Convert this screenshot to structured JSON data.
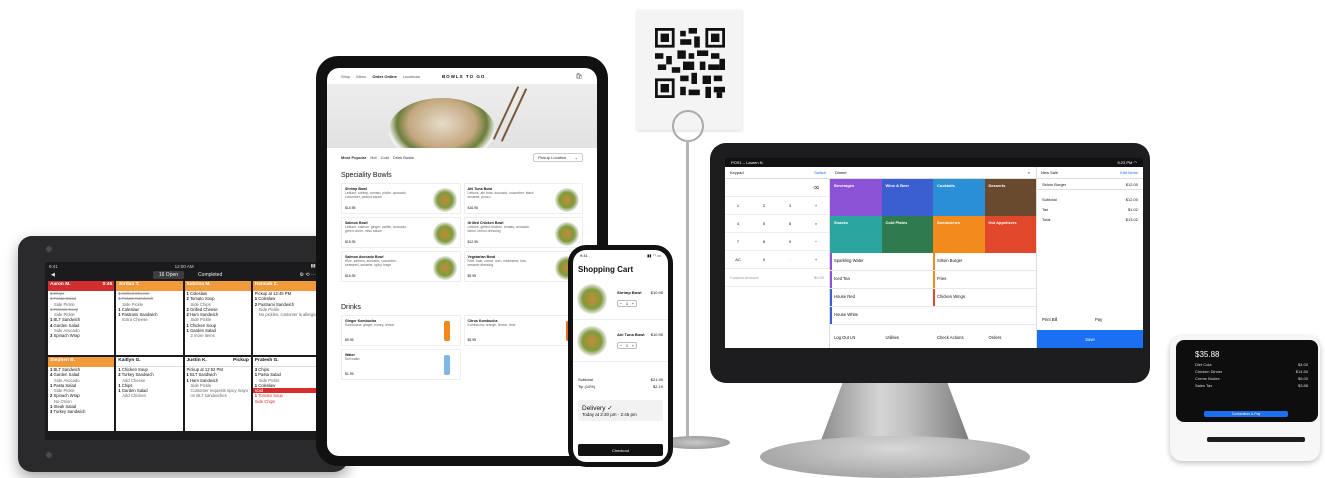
{
  "kds": {
    "status_left": "9:41",
    "status_right": "12:00 AM",
    "back": "◀",
    "tab_open": "16 Open",
    "tab_completed": "Completed",
    "tickets": [
      {
        "color": "#d12f2f",
        "name": "Aaron M.",
        "time": "0:45",
        "lines": [
          {
            "q": "1",
            "t": "Chips",
            "cls": "strike"
          },
          {
            "q": "1",
            "t": "Pasta Salad",
            "cls": "strike"
          },
          {
            "q": "",
            "t": "Side Pickle",
            "cls": "sub"
          },
          {
            "q": "1",
            "t": "Tomato Soup",
            "cls": "strike"
          },
          {
            "q": "",
            "t": "Side Pickle",
            "cls": "sub"
          },
          {
            "q": "1",
            "t": "BLT Sandwich",
            "cls": ""
          },
          {
            "q": "4",
            "t": "Garden Salad",
            "cls": ""
          },
          {
            "q": "",
            "t": "Side Avocado",
            "cls": "sub"
          },
          {
            "q": "3",
            "t": "Spinach Wrap",
            "cls": ""
          }
        ]
      },
      {
        "color": "#f2993a",
        "name": "Jordan T.",
        "time": "",
        "lines": [
          {
            "q": "1",
            "t": "Grilled Cheese",
            "cls": "strike"
          },
          {
            "q": "1",
            "t": "Potato Sandwich",
            "cls": "strike"
          },
          {
            "q": "",
            "t": "Side Pickle",
            "cls": "sub"
          },
          {
            "q": "1",
            "t": "Coleslaw",
            "cls": ""
          },
          {
            "q": "1",
            "t": "Pastrami Sandwich",
            "cls": ""
          },
          {
            "q": "",
            "t": "Extra Cheese",
            "cls": "sub"
          }
        ]
      },
      {
        "color": "#f2993a",
        "name": "Sabrina M.",
        "time": "",
        "lines": [
          {
            "q": "1",
            "t": "Coleslaw",
            "cls": ""
          },
          {
            "q": "2",
            "t": "Tomato Soup",
            "cls": ""
          },
          {
            "q": "",
            "t": "Side Chips",
            "cls": "sub"
          },
          {
            "q": "2",
            "t": "Grilled Cheese",
            "cls": ""
          },
          {
            "q": "2",
            "t": "Ham Sandwich",
            "cls": ""
          },
          {
            "q": "",
            "t": "Side Pickle",
            "cls": "sub"
          },
          {
            "q": "1",
            "t": "Chicken Soup",
            "cls": ""
          },
          {
            "q": "1",
            "t": "Garden Salad",
            "cls": ""
          },
          {
            "q": "",
            "t": "2 more items",
            "cls": "sub"
          }
        ]
      },
      {
        "color": "#f2993a",
        "name": "Hannah Z.",
        "time": "",
        "lines": [
          {
            "q": "",
            "t": "Pickup at 12:45 PM",
            "cls": ""
          },
          {
            "q": "1",
            "t": "Coleslaw",
            "cls": ""
          },
          {
            "q": "2",
            "t": "Pastrami Sandwich",
            "cls": ""
          },
          {
            "q": "",
            "t": "Side Pickle",
            "cls": "sub"
          },
          {
            "q": "",
            "t": "No pickles, customer is allergic",
            "cls": "sub"
          }
        ]
      },
      {
        "color": "#f2993a",
        "name": "Stephen B.",
        "time": "",
        "lines": [
          {
            "q": "1",
            "t": "BLT Sandwich",
            "cls": ""
          },
          {
            "q": "4",
            "t": "Garden Salad",
            "cls": ""
          },
          {
            "q": "",
            "t": "Side Avocado",
            "cls": "sub"
          },
          {
            "q": "1",
            "t": "Pasta Salad",
            "cls": ""
          },
          {
            "q": "",
            "t": "Side Pickle",
            "cls": "sub"
          },
          {
            "q": "2",
            "t": "Spinach Wrap",
            "cls": ""
          },
          {
            "q": "",
            "t": "No Onion",
            "cls": "sub"
          },
          {
            "q": "1",
            "t": "Steak Salad",
            "cls": ""
          },
          {
            "q": "3",
            "t": "Turkey Sandwich",
            "cls": ""
          }
        ]
      },
      {
        "color": "#ffffff",
        "name": "Kaitlyn G.",
        "time": "",
        "lines": [
          {
            "q": "1",
            "t": "Chicken Soup",
            "cls": ""
          },
          {
            "q": "2",
            "t": "Turkey Sandwich",
            "cls": ""
          },
          {
            "q": "",
            "t": "Add Cheese",
            "cls": "sub"
          },
          {
            "q": "1",
            "t": "Chips",
            "cls": ""
          },
          {
            "q": "1",
            "t": "Garden Salad",
            "cls": ""
          },
          {
            "q": "",
            "t": "Add Chicken",
            "cls": "sub"
          }
        ]
      },
      {
        "color": "#ffffff",
        "name": "Justin K.",
        "time": "Pickup",
        "lines": [
          {
            "q": "",
            "t": "Pickup at 12:52 PM",
            "cls": ""
          },
          {
            "q": "1",
            "t": "BLT Sandwich",
            "cls": ""
          },
          {
            "q": "1",
            "t": "Ham Sandwich",
            "cls": ""
          },
          {
            "q": "",
            "t": "Side Pickle",
            "cls": "sub"
          },
          {
            "q": "",
            "t": "Customer requests spicy mayo on BLT sandwiches",
            "cls": "sub"
          }
        ]
      },
      {
        "color": "#ffffff",
        "name": "Pratesh G.",
        "time": "",
        "lines": [
          {
            "q": "3",
            "t": "Chips",
            "cls": ""
          },
          {
            "q": "1",
            "t": "Pasta Salad",
            "cls": ""
          },
          {
            "q": "",
            "t": "Side Pickle",
            "cls": "sub"
          },
          {
            "q": "1",
            "t": "Coleslaw",
            "cls": ""
          },
          {
            "q": "",
            "t": "Void",
            "cls": "red"
          },
          {
            "q": "1",
            "t": "Tomato Soup",
            "cls": "red2"
          },
          {
            "q": "",
            "t": "Side Chips",
            "cls": "red2"
          }
        ]
      }
    ]
  },
  "ipad": {
    "nav": [
      "Shop",
      "Menu",
      "Order Online",
      "Locations"
    ],
    "brand": "BOWLS TO GO",
    "cart_icon": "bag-icon",
    "filters": [
      "Most Popular",
      "Hot",
      "Cold",
      "Drink Bowls"
    ],
    "location_select": "Pickup Location",
    "section1": "Speciality Bowls",
    "bowls": [
      {
        "name": "Shrimp Bowl",
        "desc": "Lettuce, shrimp, tomato, pickle, avocado, cucumber, peanut sauce",
        "price": "$14.95"
      },
      {
        "name": "Ahi Tuna Bowl",
        "desc": "Lettuce, ahi tuna, avocado, cucumber, black sesame, ponzu",
        "price": "$16.95"
      },
      {
        "name": "Salmon Bowl",
        "desc": "Lettuce, salmon, ginger, radish, avocado, green onion, miso sauce",
        "price": "$15.95"
      },
      {
        "name": "Grilled Chicken Bowl",
        "desc": "Lettuce, grilled chicken, tomato, avocado, tahini, lemon dressing",
        "price": "$12.95"
      },
      {
        "name": "Salmon Avocado Bowl",
        "desc": "Rice, salmon, avocado, cucumber, seaweed, sesame, spicy mayo",
        "price": "$16.95"
      },
      {
        "name": "Vegetarian Bowl",
        "desc": "Rice, kale, carrot, corn, edamame, tofu, sesame dressing",
        "price": "$9.95"
      }
    ],
    "section2": "Drinks",
    "drinks": [
      {
        "name": "Ginger Kombucha",
        "desc": "Kombucha, ginger, honey, lemon",
        "price": "$5.95",
        "color": "#f08a1c"
      },
      {
        "name": "Citrus Kombucha",
        "desc": "Kombucha, orange, lemon, lime",
        "price": "$5.95",
        "color": "#f06a1c"
      },
      {
        "name": "Water",
        "desc": "Still water",
        "price": "$1.95",
        "color": "#7db8e8"
      }
    ]
  },
  "phone": {
    "time": "9:41",
    "title": "Shopping Cart",
    "items": [
      {
        "name": "Shrimp Bowl",
        "price": "$10.95",
        "qty": "1"
      },
      {
        "name": "Ahi Tuna Bowl",
        "price": "$10.95",
        "qty": "1"
      }
    ],
    "subtotal_label": "Subtotal",
    "subtotal": "$21.90",
    "tip_label": "Tip (10%)",
    "tip": "$2.19",
    "delivery_title": "Delivery",
    "delivery_time": "Today at 2:30 pm - 2:45 pm",
    "checkout": "Checkout"
  },
  "pos": {
    "device": "POS1 – Lauren N.",
    "time": "5:23 PM",
    "keypad_label": "Keypad",
    "switch": "Switch",
    "category": "Dinner",
    "new_sale": "New Sale",
    "edit_items": "Edit Items",
    "keys": [
      [
        "",
        "",
        "",
        "⌫"
      ],
      [
        "1",
        "2",
        "3",
        "+"
      ],
      [
        "4",
        "5",
        "6",
        "×"
      ],
      [
        "7",
        "8",
        "9",
        "−"
      ],
      [
        "AC",
        "0",
        ".",
        "+"
      ]
    ],
    "custom_amount": "Custom Amount",
    "custom_value": "$0.00",
    "categories": [
      {
        "label": "Beverages",
        "color": "#8c52d6"
      },
      {
        "label": "Wine & Beer",
        "color": "#3b5fd1"
      },
      {
        "label": "Cocktails",
        "color": "#2b8fd6"
      },
      {
        "label": "Desserts",
        "color": "#6a4a2e"
      },
      {
        "label": "Snacks",
        "color": "#2aa5a0"
      },
      {
        "label": "Cold Plates",
        "color": "#2f7a4f"
      },
      {
        "label": "Sandwiches",
        "color": "#f28a1c"
      },
      {
        "label": "Hot Appetizers",
        "color": "#e0472b"
      }
    ],
    "items": [
      {
        "l": "Sparkling Water",
        "lc": "#8c52d6",
        "r": "Sirloin Burger",
        "rc": "#f28a1c"
      },
      {
        "l": "Iced Tea",
        "lc": "#8c52d6",
        "r": "Fries",
        "rc": "#f28a1c"
      },
      {
        "l": "House Red",
        "lc": "#3b5fd1",
        "r": "Chicken Wings",
        "rc": "#e0472b"
      },
      {
        "l": "House White",
        "lc": "#3b5fd1",
        "r": "",
        "rc": ""
      }
    ],
    "actions": [
      "Log Out LN",
      "Utilities",
      "Check Actions",
      "Orders"
    ],
    "sale_lines": [
      {
        "k": "Sirloin Burger",
        "v": "$12.00"
      },
      {
        "k": "Subtotal",
        "v": "$12.00"
      },
      {
        "k": "Tax",
        "v": "$1.02"
      },
      {
        "k": "Total",
        "v": "$13.02"
      }
    ],
    "print_bill": "Print Bill",
    "pay": "Pay",
    "save": "Save"
  },
  "reader": {
    "total": "$35.88",
    "lines": [
      {
        "k": "Diet Cola",
        "v": "$4.00"
      },
      {
        "k": "Chicken Dinner",
        "v": "$14.50"
      },
      {
        "k": "Creme Brulee",
        "v": "$9.00"
      },
      {
        "k": "Sales Tax",
        "v": "$3.88"
      }
    ],
    "button": "Contactless & Pay"
  }
}
